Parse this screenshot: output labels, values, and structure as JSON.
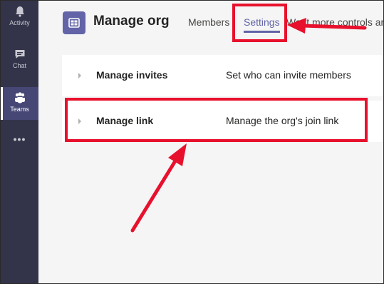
{
  "rail": {
    "items": [
      {
        "label": "Activity",
        "icon": "bell-icon"
      },
      {
        "label": "Chat",
        "icon": "chat-icon"
      },
      {
        "label": "Teams",
        "icon": "teams-icon",
        "active": true
      }
    ],
    "more": "•••"
  },
  "header": {
    "title": "Manage org",
    "tabs": [
      {
        "label": "Members"
      },
      {
        "label": "Settings",
        "selected": true
      },
      {
        "label": "Want more controls ar"
      }
    ]
  },
  "settings": {
    "rows": [
      {
        "title": "Manage invites",
        "description": "Set who can invite members"
      },
      {
        "title": "Manage link",
        "description": "Manage the org's join link"
      }
    ]
  },
  "colors": {
    "rail_bg": "#33344a",
    "accent": "#6264a7",
    "annotation_red": "#e8112d"
  }
}
